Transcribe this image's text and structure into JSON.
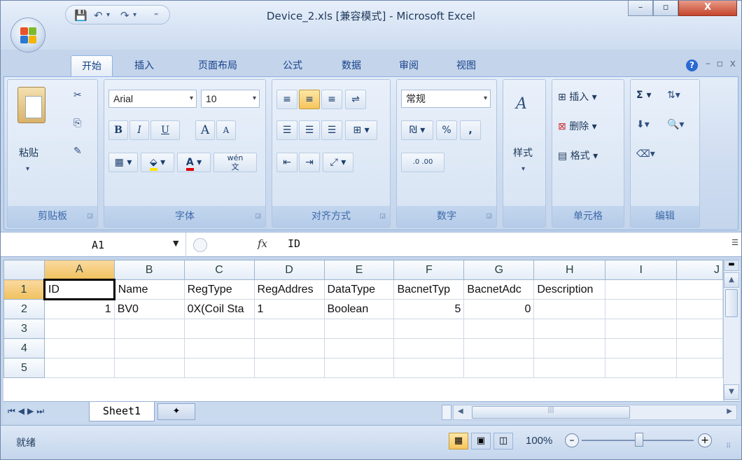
{
  "window": {
    "title": "Device_2.xls  [兼容模式] - Microsoft Excel",
    "minimize_label": "–",
    "restore_label": "▫",
    "close_label": "X"
  },
  "tabs": [
    "开始",
    "插入",
    "页面布局",
    "公式",
    "数据",
    "审阅",
    "视图"
  ],
  "active_tab": "开始",
  "ribbon": {
    "clipboard": {
      "paste_label": "粘贴",
      "group_label": "剪贴板"
    },
    "font": {
      "font_name": "Arial",
      "font_size": "10",
      "bold": "B",
      "italic": "I",
      "underline": "U",
      "grow": "A",
      "shrink": "A",
      "wen": "wén",
      "wen_char": "文",
      "group_label": "字体"
    },
    "alignment": {
      "group_label": "对齐方式"
    },
    "number": {
      "format": "常规",
      "percent": "%",
      "comma": ",",
      "dec_inc": ".0 .00",
      "group_label": "数字"
    },
    "styles": {
      "label": "样式"
    },
    "cells": {
      "insert": "插入",
      "delete": "删除",
      "format": "格式",
      "group_label": "单元格"
    },
    "editing": {
      "sigma": "Σ",
      "group_label": "编辑"
    }
  },
  "formula_bar": {
    "name_box": "A1",
    "fx": "fx",
    "value": "ID"
  },
  "grid": {
    "columns": [
      "A",
      "B",
      "C",
      "D",
      "E",
      "F",
      "G",
      "H",
      "I",
      "J"
    ],
    "rows": [
      {
        "num": "1",
        "cells": [
          "ID",
          "Name",
          "RegType",
          "RegAddres",
          "DataType",
          "BacnetTyp",
          "BacnetAdc",
          "Description",
          "",
          ""
        ]
      },
      {
        "num": "2",
        "cells": [
          "1",
          "BV0",
          "0X(Coil Sta",
          "1",
          "Boolean",
          "5",
          "0",
          "",
          "",
          ""
        ]
      },
      {
        "num": "3",
        "cells": [
          "",
          "",
          "",
          "",
          "",
          "",
          "",
          "",
          "",
          ""
        ]
      },
      {
        "num": "4",
        "cells": [
          "",
          "",
          "",
          "",
          "",
          "",
          "",
          "",
          "",
          ""
        ]
      },
      {
        "num": "5",
        "cells": [
          "",
          "",
          "",
          "",
          "",
          "",
          "",
          "",
          "",
          ""
        ]
      }
    ],
    "active_cell": "A1"
  },
  "sheets": {
    "active": "Sheet1"
  },
  "status": {
    "text": "就绪",
    "zoom": "100%"
  },
  "colors": {
    "accent": "#15428b",
    "selected_header": "#f1c15f",
    "close_red": "#c5452b"
  }
}
